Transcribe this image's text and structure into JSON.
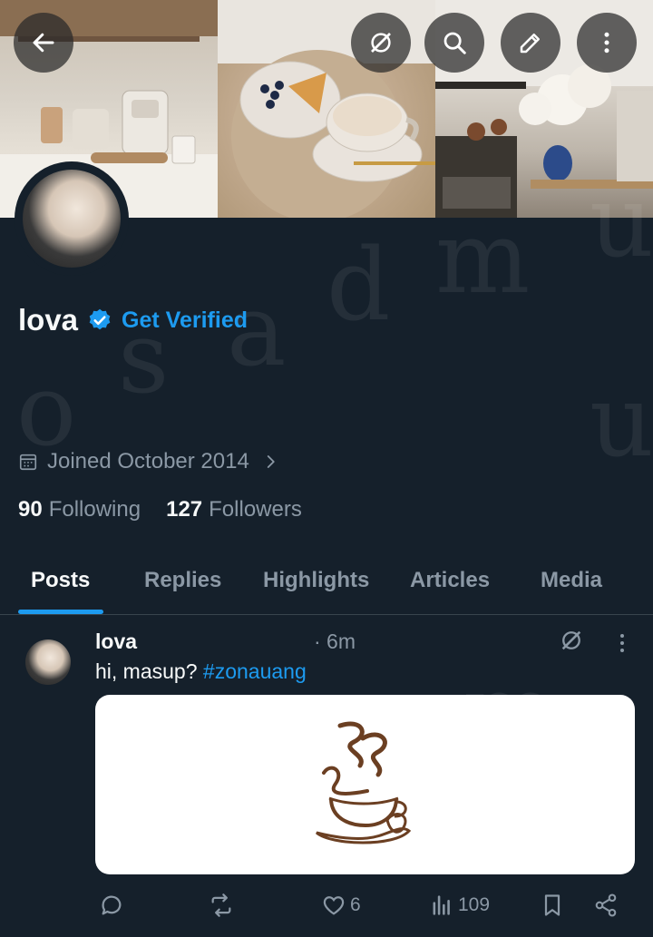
{
  "profile": {
    "name": "lova",
    "get_verified": "Get Verified",
    "joined": "Joined October 2014",
    "following_count": "90",
    "following_label": "Following",
    "followers_count": "127",
    "followers_label": "Followers"
  },
  "tabs": [
    {
      "label": "Posts"
    },
    {
      "label": "Replies"
    },
    {
      "label": "Highlights"
    },
    {
      "label": "Articles"
    },
    {
      "label": "Media"
    }
  ],
  "post": {
    "author": "lova",
    "time": "· 6m",
    "text": "hi, masup?",
    "hashtag": "#zonauang",
    "likes": "6",
    "views": "109"
  },
  "watermark": [
    "o",
    "s",
    "a",
    "d",
    "m",
    "u"
  ],
  "colors": {
    "background": "#15202b",
    "accent": "#1d9bf0",
    "muted": "#8b98a5",
    "text": "#f7f9f9"
  },
  "icons": [
    "back-arrow-icon",
    "grok-icon",
    "search-icon",
    "edit-icon",
    "more-icon",
    "verified-badge-icon",
    "calendar-icon",
    "chevron-right-icon",
    "reply-icon",
    "repost-icon",
    "like-icon",
    "views-icon",
    "bookmark-icon",
    "share-icon"
  ]
}
